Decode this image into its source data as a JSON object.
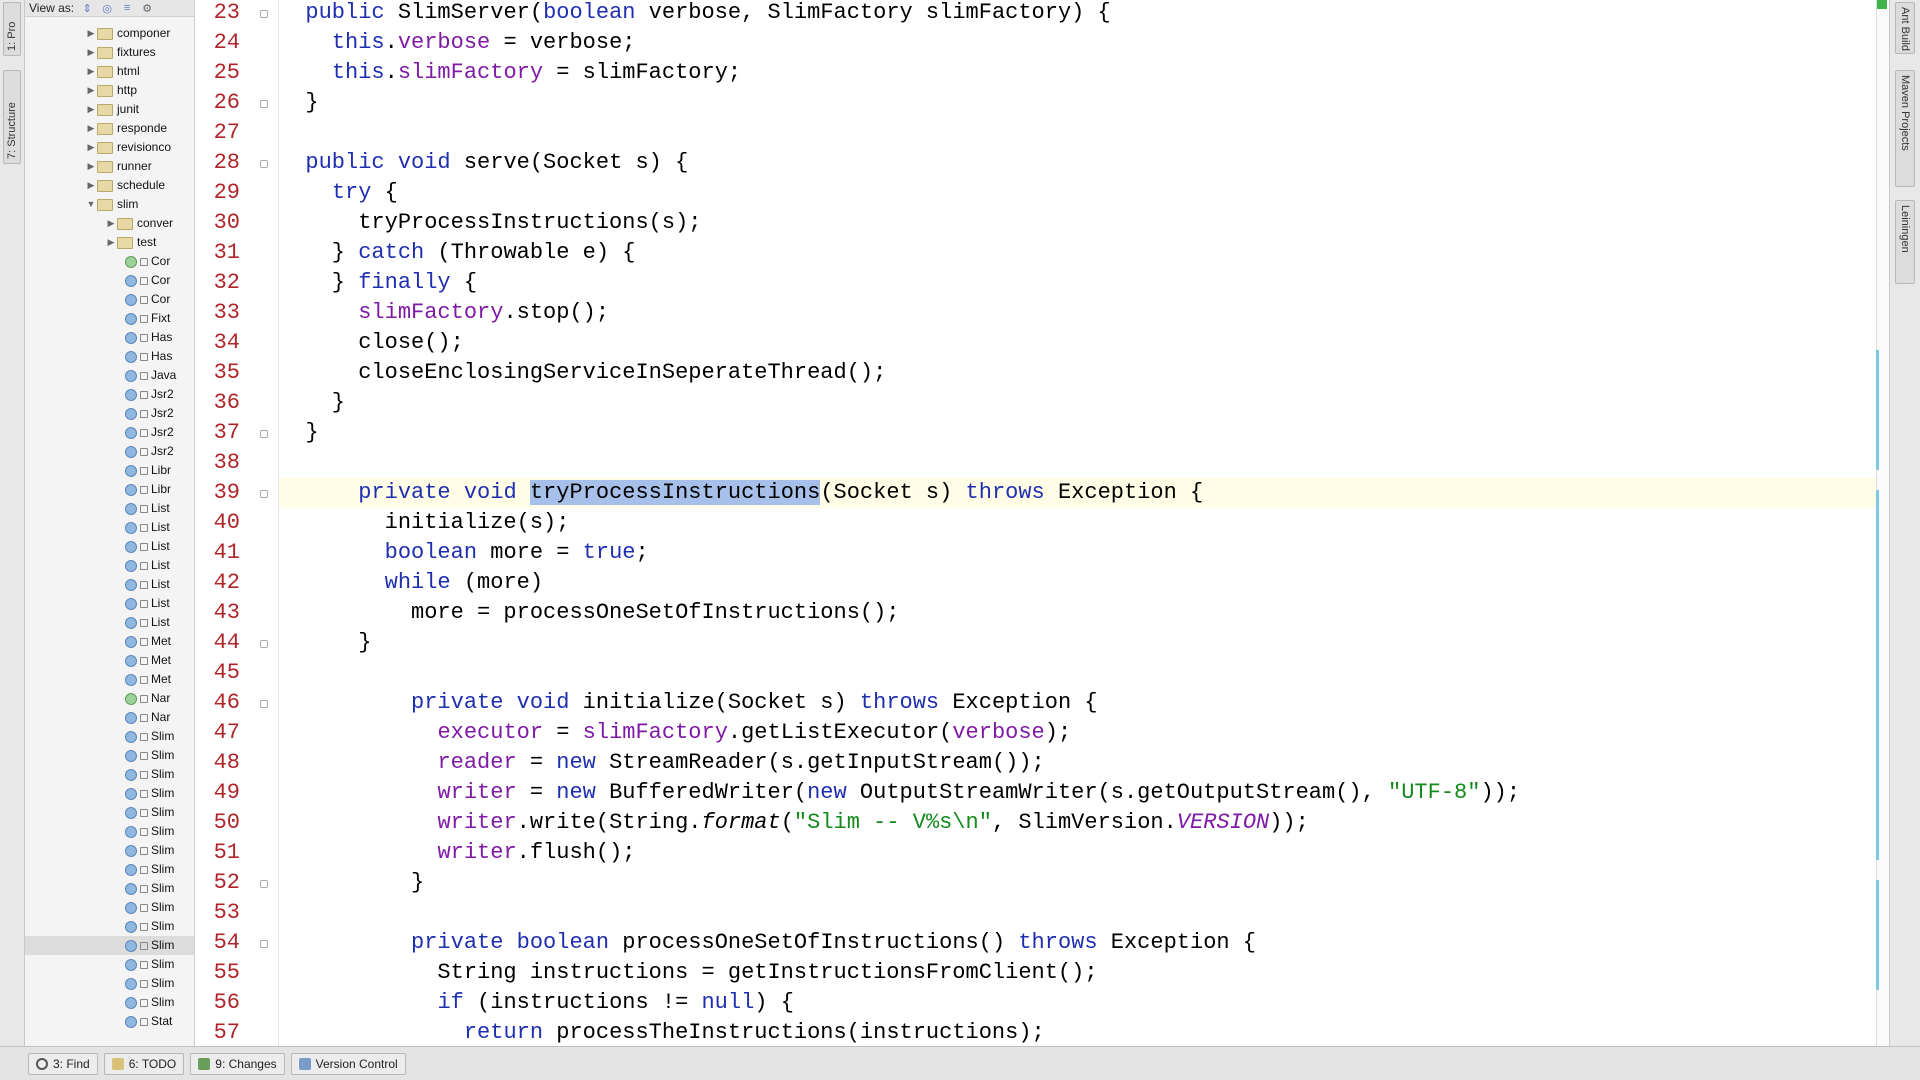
{
  "left_strip": {
    "tab_project": "1: Pro",
    "tab_structure": "7: Structure"
  },
  "panel": {
    "view_as_label": "View as:"
  },
  "tree": [
    {
      "label": "componer",
      "indent": 1,
      "kind": "folder",
      "expanded": false
    },
    {
      "label": "fixtures",
      "indent": 1,
      "kind": "folder",
      "expanded": false
    },
    {
      "label": "html",
      "indent": 1,
      "kind": "folder",
      "expanded": false
    },
    {
      "label": "http",
      "indent": 1,
      "kind": "folder",
      "expanded": false
    },
    {
      "label": "junit",
      "indent": 1,
      "kind": "folder",
      "expanded": false
    },
    {
      "label": "responde",
      "indent": 1,
      "kind": "folder",
      "expanded": false
    },
    {
      "label": "revisionco",
      "indent": 1,
      "kind": "folder",
      "expanded": false
    },
    {
      "label": "runner",
      "indent": 1,
      "kind": "folder",
      "expanded": false
    },
    {
      "label": "schedule",
      "indent": 1,
      "kind": "folder",
      "expanded": false
    },
    {
      "label": "slim",
      "indent": 1,
      "kind": "folder",
      "expanded": true
    },
    {
      "label": "conver",
      "indent": 2,
      "kind": "folder",
      "expanded": false
    },
    {
      "label": "test",
      "indent": 2,
      "kind": "folder",
      "expanded": false
    },
    {
      "label": "Cor",
      "indent": 3,
      "kind": "interface"
    },
    {
      "label": "Cor",
      "indent": 3,
      "kind": "class"
    },
    {
      "label": "Cor",
      "indent": 3,
      "kind": "class"
    },
    {
      "label": "Fixt",
      "indent": 3,
      "kind": "class"
    },
    {
      "label": "Has",
      "indent": 3,
      "kind": "class"
    },
    {
      "label": "Has",
      "indent": 3,
      "kind": "class"
    },
    {
      "label": "Java",
      "indent": 3,
      "kind": "class"
    },
    {
      "label": "Jsr2",
      "indent": 3,
      "kind": "class"
    },
    {
      "label": "Jsr2",
      "indent": 3,
      "kind": "class"
    },
    {
      "label": "Jsr2",
      "indent": 3,
      "kind": "class"
    },
    {
      "label": "Jsr2",
      "indent": 3,
      "kind": "class"
    },
    {
      "label": "Libr",
      "indent": 3,
      "kind": "class"
    },
    {
      "label": "Libr",
      "indent": 3,
      "kind": "class"
    },
    {
      "label": "List",
      "indent": 3,
      "kind": "class"
    },
    {
      "label": "List",
      "indent": 3,
      "kind": "class"
    },
    {
      "label": "List",
      "indent": 3,
      "kind": "class"
    },
    {
      "label": "List",
      "indent": 3,
      "kind": "class"
    },
    {
      "label": "List",
      "indent": 3,
      "kind": "class"
    },
    {
      "label": "List",
      "indent": 3,
      "kind": "class"
    },
    {
      "label": "List",
      "indent": 3,
      "kind": "class"
    },
    {
      "label": "Met",
      "indent": 3,
      "kind": "class"
    },
    {
      "label": "Met",
      "indent": 3,
      "kind": "class"
    },
    {
      "label": "Met",
      "indent": 3,
      "kind": "class"
    },
    {
      "label": "Nar",
      "indent": 3,
      "kind": "interface"
    },
    {
      "label": "Nar",
      "indent": 3,
      "kind": "class"
    },
    {
      "label": "Slim",
      "indent": 3,
      "kind": "class"
    },
    {
      "label": "Slim",
      "indent": 3,
      "kind": "class"
    },
    {
      "label": "Slim",
      "indent": 3,
      "kind": "class"
    },
    {
      "label": "Slim",
      "indent": 3,
      "kind": "class"
    },
    {
      "label": "Slim",
      "indent": 3,
      "kind": "class"
    },
    {
      "label": "Slim",
      "indent": 3,
      "kind": "class"
    },
    {
      "label": "Slim",
      "indent": 3,
      "kind": "class"
    },
    {
      "label": "Slim",
      "indent": 3,
      "kind": "class"
    },
    {
      "label": "Slim",
      "indent": 3,
      "kind": "class"
    },
    {
      "label": "Slim",
      "indent": 3,
      "kind": "class"
    },
    {
      "label": "Slim",
      "indent": 3,
      "kind": "class"
    },
    {
      "label": "Slim",
      "indent": 3,
      "kind": "class",
      "selected": true
    },
    {
      "label": "Slim",
      "indent": 3,
      "kind": "class"
    },
    {
      "label": "Slim",
      "indent": 3,
      "kind": "class"
    },
    {
      "label": "Slim",
      "indent": 3,
      "kind": "class"
    },
    {
      "label": "Stat",
      "indent": 3,
      "kind": "class"
    }
  ],
  "code": [
    {
      "n": "23",
      "fold": true,
      "tokens": [
        [
          "",
          "  "
        ],
        [
          "kw",
          "public"
        ],
        [
          "",
          " SlimServer("
        ],
        [
          "kw",
          "boolean"
        ],
        [
          "",
          " verbose, SlimFactory slimFactory) {"
        ]
      ]
    },
    {
      "n": "24",
      "tokens": [
        [
          "",
          "    "
        ],
        [
          "kw",
          "this"
        ],
        [
          "",
          "."
        ],
        [
          "fld",
          "verbose"
        ],
        [
          "",
          " = verbose;"
        ]
      ]
    },
    {
      "n": "25",
      "tokens": [
        [
          "",
          "    "
        ],
        [
          "kw",
          "this"
        ],
        [
          "",
          "."
        ],
        [
          "fld",
          "slimFactory"
        ],
        [
          "",
          " = slimFactory;"
        ]
      ]
    },
    {
      "n": "26",
      "fold": true,
      "tokens": [
        [
          "",
          "  }"
        ]
      ]
    },
    {
      "n": "27",
      "tokens": [
        [
          "",
          ""
        ]
      ]
    },
    {
      "n": "28",
      "fold": true,
      "tokens": [
        [
          "",
          "  "
        ],
        [
          "kw",
          "public void"
        ],
        [
          "",
          " serve(Socket s) {"
        ]
      ]
    },
    {
      "n": "29",
      "tokens": [
        [
          "",
          "    "
        ],
        [
          "kw",
          "try"
        ],
        [
          "",
          " {"
        ]
      ]
    },
    {
      "n": "30",
      "tokens": [
        [
          "",
          "      tryProcessInstructions(s);"
        ]
      ]
    },
    {
      "n": "31",
      "tokens": [
        [
          "",
          "    } "
        ],
        [
          "kw",
          "catch"
        ],
        [
          "",
          " (Throwable e) {"
        ]
      ]
    },
    {
      "n": "32",
      "tokens": [
        [
          "",
          "    } "
        ],
        [
          "kw",
          "finally"
        ],
        [
          "",
          " {"
        ]
      ]
    },
    {
      "n": "33",
      "tokens": [
        [
          "",
          "      "
        ],
        [
          "fld",
          "slimFactory"
        ],
        [
          "",
          ".stop();"
        ]
      ]
    },
    {
      "n": "34",
      "tokens": [
        [
          "",
          "      close();"
        ]
      ]
    },
    {
      "n": "35",
      "tokens": [
        [
          "",
          "      closeEnclosingServiceInSeperateThread();"
        ]
      ]
    },
    {
      "n": "36",
      "tokens": [
        [
          "",
          "    }"
        ]
      ]
    },
    {
      "n": "37",
      "fold": true,
      "tokens": [
        [
          "",
          "  }"
        ]
      ]
    },
    {
      "n": "38",
      "tokens": [
        [
          "",
          ""
        ]
      ]
    },
    {
      "n": "39",
      "fold": true,
      "current": true,
      "tokens": [
        [
          "",
          "      "
        ],
        [
          "kw",
          "private void"
        ],
        [
          "",
          " "
        ],
        [
          "sel",
          "tryProcessInstructions"
        ],
        [
          "",
          "(Socket s) "
        ],
        [
          "kw",
          "throws"
        ],
        [
          "",
          " Exception {"
        ]
      ]
    },
    {
      "n": "40",
      "tokens": [
        [
          "",
          "        initialize(s);"
        ]
      ]
    },
    {
      "n": "41",
      "tokens": [
        [
          "",
          "        "
        ],
        [
          "kw",
          "boolean"
        ],
        [
          "",
          " more = "
        ],
        [
          "kw",
          "true"
        ],
        [
          "",
          ";"
        ]
      ]
    },
    {
      "n": "42",
      "tokens": [
        [
          "",
          "        "
        ],
        [
          "kw",
          "while"
        ],
        [
          "",
          " (more)"
        ]
      ]
    },
    {
      "n": "43",
      "tokens": [
        [
          "",
          "          more = processOneSetOfInstructions();"
        ]
      ]
    },
    {
      "n": "44",
      "fold": true,
      "tokens": [
        [
          "",
          "      }"
        ]
      ]
    },
    {
      "n": "45",
      "tokens": [
        [
          "",
          ""
        ]
      ]
    },
    {
      "n": "46",
      "fold": true,
      "tokens": [
        [
          "",
          "          "
        ],
        [
          "kw",
          "private void"
        ],
        [
          "",
          " initialize(Socket s) "
        ],
        [
          "kw",
          "throws"
        ],
        [
          "",
          " Exception {"
        ]
      ]
    },
    {
      "n": "47",
      "tokens": [
        [
          "",
          "            "
        ],
        [
          "fld",
          "executor"
        ],
        [
          "",
          " = "
        ],
        [
          "fld",
          "slimFactory"
        ],
        [
          "",
          ".getListExecutor("
        ],
        [
          "fld",
          "verbose"
        ],
        [
          "",
          ");"
        ]
      ]
    },
    {
      "n": "48",
      "tokens": [
        [
          "",
          "            "
        ],
        [
          "fld",
          "reader"
        ],
        [
          "",
          " = "
        ],
        [
          "kw",
          "new"
        ],
        [
          "",
          " StreamReader(s.getInputStream());"
        ]
      ]
    },
    {
      "n": "49",
      "tokens": [
        [
          "",
          "            "
        ],
        [
          "fld",
          "writer"
        ],
        [
          "",
          " = "
        ],
        [
          "kw",
          "new"
        ],
        [
          "",
          " BufferedWriter("
        ],
        [
          "kw",
          "new"
        ],
        [
          "",
          " OutputStreamWriter(s.getOutputStream(), "
        ],
        [
          "str",
          "\"UTF-8\""
        ],
        [
          "",
          "));"
        ]
      ]
    },
    {
      "n": "50",
      "tokens": [
        [
          "",
          "            "
        ],
        [
          "fld",
          "writer"
        ],
        [
          "",
          ".write(String."
        ],
        [
          "it",
          "format"
        ],
        [
          "",
          "("
        ],
        [
          "str",
          "\"Slim -- V%s\\n\""
        ],
        [
          "",
          ", SlimVersion."
        ],
        [
          "itfld",
          "VERSION"
        ],
        [
          "",
          "));"
        ]
      ]
    },
    {
      "n": "51",
      "tokens": [
        [
          "",
          "            "
        ],
        [
          "fld",
          "writer"
        ],
        [
          "",
          ".flush();"
        ]
      ]
    },
    {
      "n": "52",
      "fold": true,
      "tokens": [
        [
          "",
          "          }"
        ]
      ]
    },
    {
      "n": "53",
      "tokens": [
        [
          "",
          ""
        ]
      ]
    },
    {
      "n": "54",
      "fold": true,
      "tokens": [
        [
          "",
          "          "
        ],
        [
          "kw",
          "private boolean"
        ],
        [
          "",
          " processOneSetOfInstructions() "
        ],
        [
          "kw",
          "throws"
        ],
        [
          "",
          " Exception {"
        ]
      ]
    },
    {
      "n": "55",
      "tokens": [
        [
          "",
          "            String instructions = getInstructionsFromClient();"
        ]
      ]
    },
    {
      "n": "56",
      "tokens": [
        [
          "",
          "            "
        ],
        [
          "kw",
          "if"
        ],
        [
          "",
          " (instructions != "
        ],
        [
          "kw",
          "null"
        ],
        [
          "",
          ") {"
        ]
      ]
    },
    {
      "n": "57",
      "tokens": [
        [
          "",
          "              "
        ],
        [
          "kw",
          "return"
        ],
        [
          "",
          " processTheInstructions(instructions);"
        ]
      ]
    }
  ],
  "right_strip": {
    "tab_ant": "Ant Build",
    "tab_maven": "Maven Projects",
    "tab_leiningen": "Leiningen"
  },
  "bottom": {
    "find": "3: Find",
    "todo": "6: TODO",
    "changes": "9: Changes",
    "vcs": "Version Control"
  },
  "colors": {
    "line_number": "#b0252a",
    "keyword": "#1f2eb0",
    "field": "#7f1aa6",
    "string": "#138a1c",
    "selection": "#a7c0ea"
  }
}
